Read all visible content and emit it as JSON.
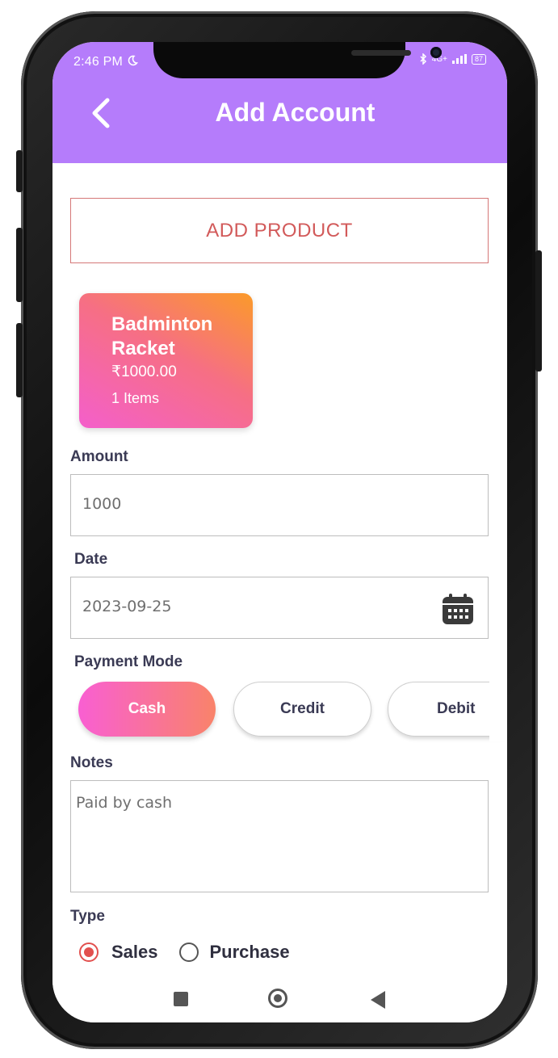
{
  "status_bar": {
    "time": "2:46 PM",
    "network": "4G+",
    "battery": "87"
  },
  "header": {
    "title": "Add Account"
  },
  "add_product_label": "ADD PRODUCT",
  "product_card": {
    "name": "Badminton Racket",
    "price": "₹1000.00",
    "count": "1 Items"
  },
  "amount": {
    "label": "Amount",
    "value": "1000"
  },
  "date": {
    "label": "Date",
    "value": "2023-09-25"
  },
  "payment_mode": {
    "label": "Payment Mode",
    "options": [
      "Cash",
      "Credit",
      "Debit"
    ],
    "selected": "Cash"
  },
  "notes": {
    "label": "Notes",
    "value": "Paid by cash"
  },
  "type": {
    "label": "Type",
    "options": [
      "Sales",
      "Purchase"
    ],
    "selected": "Sales"
  },
  "colors": {
    "header": "#b57cfb",
    "accent": "#e2504e",
    "gradient_start": "#f95fd2",
    "gradient_end": "#f9836a"
  }
}
